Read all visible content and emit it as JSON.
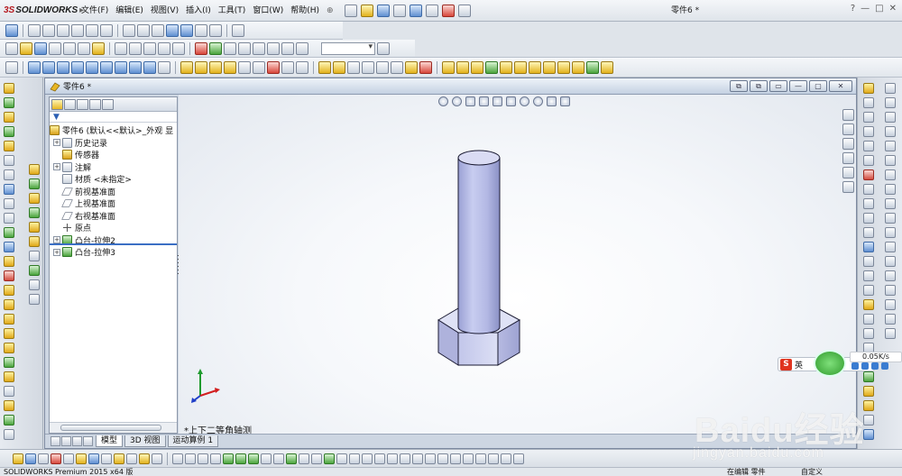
{
  "app": {
    "logo_ds": "3S",
    "logo_text": "SOLIDWORKS",
    "document_title": "零件6 *"
  },
  "menu": {
    "items": [
      "文件(F)",
      "编辑(E)",
      "视图(V)",
      "插入(I)",
      "工具(T)",
      "窗口(W)",
      "帮助(H)"
    ],
    "pin": "⊕"
  },
  "window_controls": {
    "help": "?",
    "minimize": "—",
    "restore": "□",
    "close": "✕"
  },
  "doc_window": {
    "title": "零件6 *",
    "buttons": [
      "⧉",
      "⧉",
      "▭",
      "—",
      "▢",
      "✕"
    ]
  },
  "feature_tree": {
    "filter_icon": "filter-icon",
    "root": "零件6 (默认<<默认>_外观 显",
    "items": [
      {
        "label": "历史记录",
        "expand": "+",
        "icon": "folder"
      },
      {
        "label": "传感器",
        "expand": "",
        "icon": "sensor"
      },
      {
        "label": "注解",
        "expand": "+",
        "icon": "annotation"
      },
      {
        "label": "材质 <未指定>",
        "expand": "",
        "icon": "material"
      },
      {
        "label": "前视基准面",
        "expand": "",
        "icon": "plane"
      },
      {
        "label": "上视基准面",
        "expand": "",
        "icon": "plane"
      },
      {
        "label": "右视基准面",
        "expand": "",
        "icon": "plane"
      },
      {
        "label": "原点",
        "expand": "",
        "icon": "origin"
      },
      {
        "label": "凸台-拉伸2",
        "expand": "+",
        "icon": "feature"
      },
      {
        "label": "凸台-拉伸3",
        "expand": "+",
        "icon": "feature"
      }
    ]
  },
  "viewport": {
    "view_label": "*上下二等角轴测"
  },
  "bottom_tabs": [
    "模型",
    "3D 视图",
    "运动算例 1"
  ],
  "status": {
    "product": "SOLIDWORKS Premium 2015 x64 版",
    "editing": "在编辑 零件",
    "custom": "自定义"
  },
  "ime": {
    "logo": "S",
    "lang": "英",
    "speed": "0.05K/s"
  },
  "watermark": {
    "text": "Baidu经验",
    "url": "jingyan.baidu.com"
  }
}
